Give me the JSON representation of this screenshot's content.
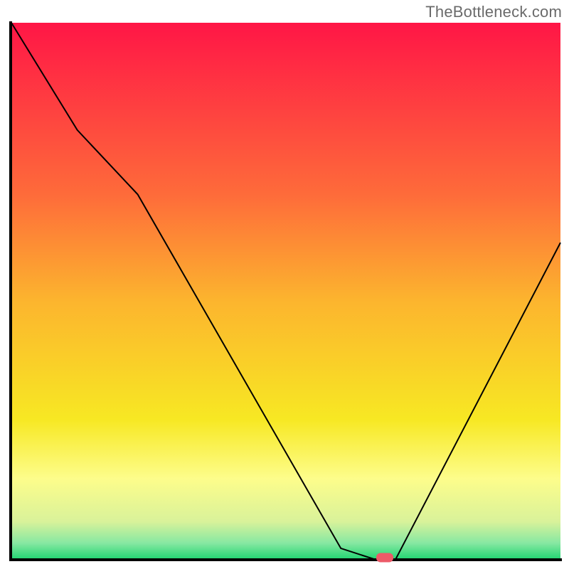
{
  "watermark": "TheBottleneck.com",
  "chart_data": {
    "type": "line",
    "title": "",
    "xlabel": "",
    "ylabel": "",
    "xlim": [
      0,
      100
    ],
    "ylim": [
      0,
      100
    ],
    "grid": false,
    "legend": false,
    "axes_visible": false,
    "series": [
      {
        "name": "curve",
        "x": [
          0,
          12,
          23,
          60,
          66,
          70,
          100
        ],
        "values": [
          100,
          80,
          68,
          2,
          0,
          0,
          59
        ]
      }
    ],
    "marker": {
      "x": 68,
      "y": 0,
      "color": "#ec5a68"
    },
    "background_gradient": {
      "stops": [
        {
          "offset": 0.0,
          "color": "#ff1646"
        },
        {
          "offset": 0.32,
          "color": "#fe6b3a"
        },
        {
          "offset": 0.52,
          "color": "#fcb52e"
        },
        {
          "offset": 0.74,
          "color": "#f7e823"
        },
        {
          "offset": 0.85,
          "color": "#fdfd8b"
        },
        {
          "offset": 0.93,
          "color": "#d9f29a"
        },
        {
          "offset": 0.97,
          "color": "#87e8a2"
        },
        {
          "offset": 1.0,
          "color": "#23d572"
        }
      ]
    },
    "colors": {
      "axis": "#000000",
      "line": "#000000",
      "marker": "#ec5a68"
    }
  }
}
